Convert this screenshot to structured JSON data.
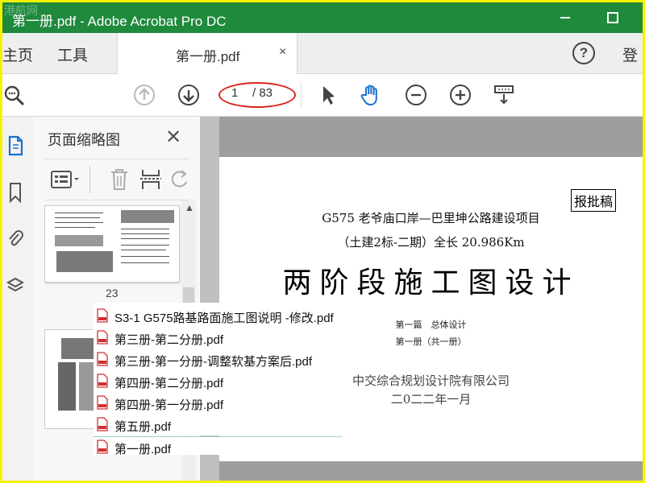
{
  "window": {
    "title": "第一册.pdf - Adobe Acrobat Pro DC",
    "watermark": "港航网"
  },
  "tabs": {
    "home": "主页",
    "tools": "工具",
    "document": "第一册.pdf",
    "close": "×",
    "help": "?",
    "signin": "登"
  },
  "toolbar": {
    "page_current": "1",
    "page_total": "/ 83"
  },
  "panel": {
    "title": "页面缩略图",
    "close": "✕",
    "thumb_label": "23"
  },
  "document": {
    "stamp": "报批稿",
    "title_line1": "G575 老爷庙口岸—巴里坤公路建设项目",
    "title_line2": "（土建2标-二期）全长 20.986Km",
    "big_title": "两阶段施工图设计",
    "part": "第一篇　总体设计",
    "volume": "第一册（共一册）",
    "organization": "中交综合规划设计院有限公司",
    "date": "二0二二年一月"
  },
  "files": [
    "S3-1 G575路基路面施工图说明 -修改.pdf",
    "第三册-第二分册.pdf",
    "第三册-第一分册-调整软基方案后.pdf",
    "第四册-第二分册.pdf",
    "第四册-第一分册.pdf",
    "第五册.pdf",
    "第一册.pdf"
  ],
  "colors": {
    "titlebar": "#1f8a3c",
    "highlight_border": "#f5f200",
    "annotation_oval": "#e0241b",
    "hand_tool": "#1a6fd1",
    "pdf_icon": "#d32f2f"
  }
}
